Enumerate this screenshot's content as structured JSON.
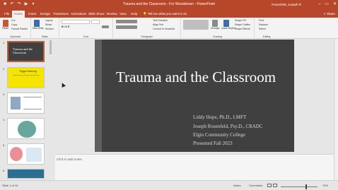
{
  "window": {
    "title": "Trauma and the Classroom - For Woodstown - PowerPoint",
    "user": "Rosenfeld, Joseph R",
    "controls": [
      "–",
      "▭",
      "✕"
    ]
  },
  "tabs": [
    "File",
    "Home",
    "Insert",
    "Design",
    "Transitions",
    "Animations",
    "Slide Show",
    "Review",
    "View",
    "Help"
  ],
  "active_tab": "Home",
  "tell_me": "Tell me what you want to do",
  "share": "Share",
  "ribbon": {
    "groups": [
      "Clipboard",
      "Slides",
      "Font",
      "Paragraph",
      "Drawing",
      "Editing"
    ],
    "clipboard": {
      "paste": "Paste",
      "cut": "Cut",
      "copy": "Copy",
      "format_painter": "Format Painter"
    },
    "slides": {
      "new_slide": "New Slide",
      "layout": "Layout",
      "reset": "Reset",
      "section": "Section"
    },
    "paragraph": {
      "text_direction": "Text Direction",
      "align_text": "Align Text",
      "convert_smartart": "Convert to SmartArt"
    },
    "drawing": {
      "arrange": "Arrange",
      "quick_styles": "Quick Styles",
      "shape_fill": "Shape Fill",
      "shape_outline": "Shape Outline",
      "shape_effects": "Shape Effects"
    },
    "editing": {
      "find": "Find",
      "replace": "Replace",
      "select": "Select"
    }
  },
  "slide": {
    "title": "Trauma and the Classroom",
    "subtitle_lines": [
      "Liddy Hope, Ph.D., LMFT",
      "Joseph Rosenfeld, Psy.D., CRADC",
      "Elgin Community College",
      "Presented Fall 2023"
    ]
  },
  "thumbnails": [
    {
      "num": "1",
      "title_line1": "Trauma and the",
      "title_line2": "Classroom",
      "bg": "#404040"
    },
    {
      "num": "2",
      "title_line1": "Trigger Warning",
      "bg": "#f5e400"
    },
    {
      "num": "3",
      "bg": "#ffffff"
    },
    {
      "num": "4",
      "bg": "#ffffff"
    },
    {
      "num": "5",
      "bg": "#ffffff"
    },
    {
      "num": "6",
      "bg": "#2a6f8f"
    }
  ],
  "notes_placeholder": "Click to add notes",
  "status": {
    "slide_of": "Slide 1 of 18",
    "notes": "Notes",
    "comments": "Comments",
    "zoom": "74%"
  },
  "colors": {
    "accent": "#b7472a",
    "slide_bg": "#404040"
  }
}
